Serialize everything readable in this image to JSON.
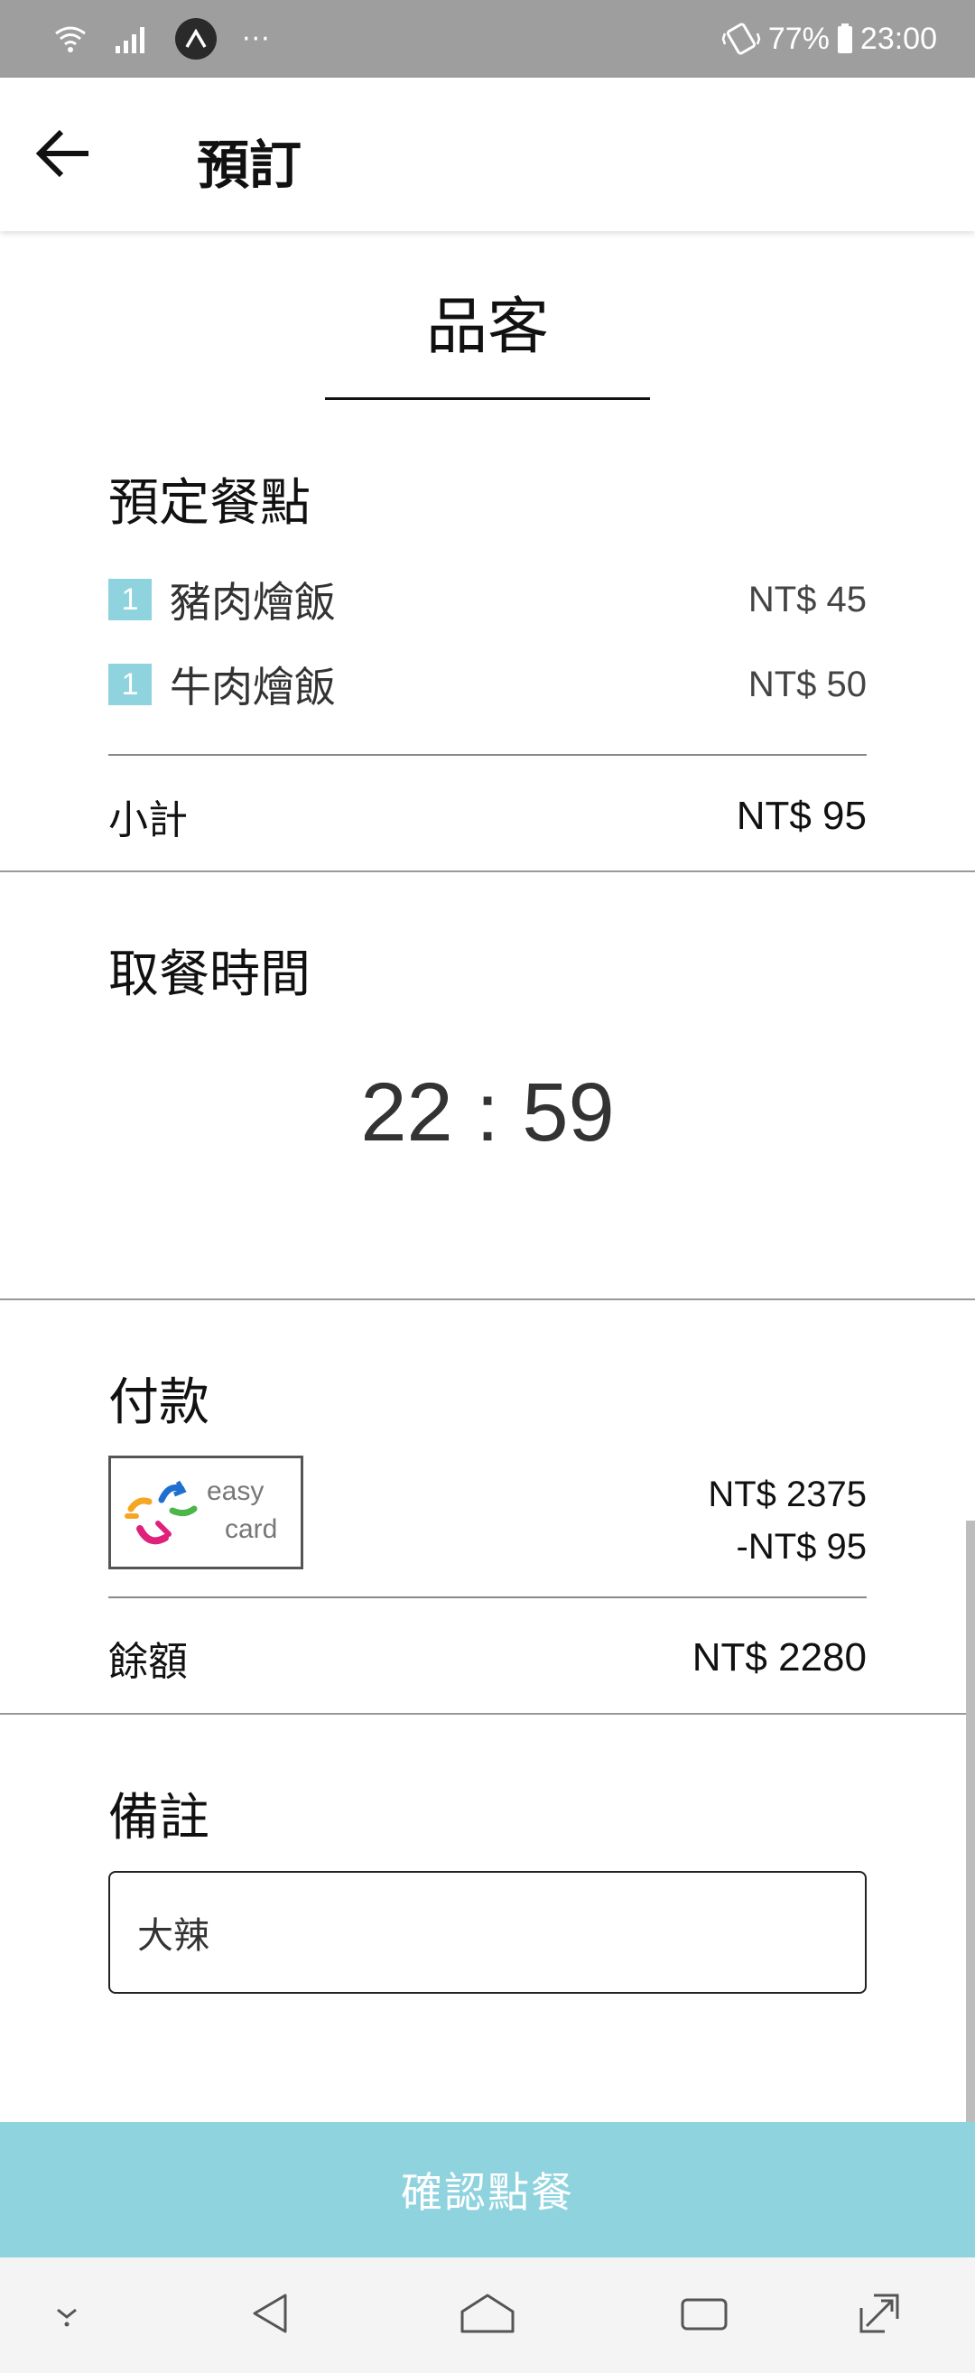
{
  "status_bar": {
    "battery": "77%",
    "time": "23:00",
    "more": "···"
  },
  "header": {
    "title": "預訂"
  },
  "shop": {
    "name": "品客"
  },
  "order": {
    "section_title": "預定餐點",
    "items": [
      {
        "qty": "1",
        "name": "豬肉燴飯",
        "price": "NT$ 45"
      },
      {
        "qty": "1",
        "name": "牛肉燴飯",
        "price": "NT$ 50"
      }
    ],
    "subtotal_label": "小計",
    "subtotal_value": "NT$ 95"
  },
  "pickup": {
    "section_title": "取餐時間",
    "time": "22 : 59"
  },
  "payment": {
    "section_title": "付款",
    "card_text_line1": "easy",
    "card_text_line2": "card",
    "balance_before": "NT$ 2375",
    "charge": "-NT$ 95",
    "remaining_label": "餘額",
    "remaining_value": "NT$ 2280"
  },
  "note": {
    "section_title": "備註",
    "value": "大辣"
  },
  "confirm_button": {
    "label": "確認點餐"
  },
  "colors": {
    "accent": "#8fd3df",
    "status_bar": "#9e9e9e"
  }
}
